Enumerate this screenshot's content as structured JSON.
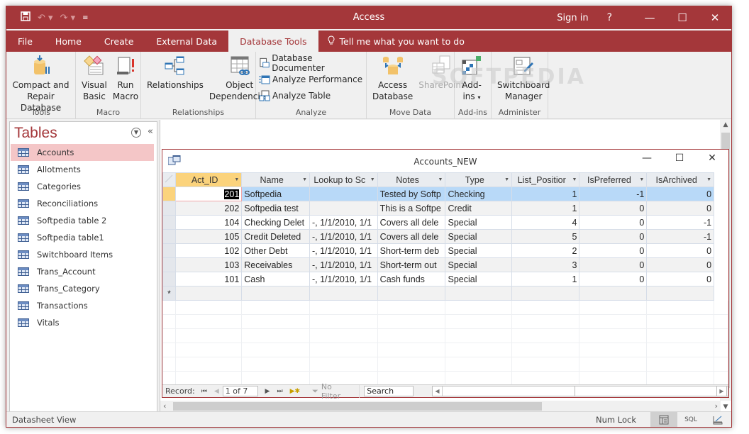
{
  "titlebar": {
    "title": "Access",
    "sign_in": "Sign in",
    "help": "?",
    "qat_icons": [
      "save-icon",
      "undo-icon",
      "redo-icon",
      "customize-qat-icon"
    ]
  },
  "tabs": [
    {
      "label": "File",
      "active": false
    },
    {
      "label": "Home",
      "active": false
    },
    {
      "label": "Create",
      "active": false
    },
    {
      "label": "External Data",
      "active": false
    },
    {
      "label": "Database Tools",
      "active": true
    }
  ],
  "tell_me": "Tell me what you want to do",
  "ribbon": {
    "groups": [
      {
        "label": "Tools",
        "buttons": [
          {
            "label": "Compact and Repair Database"
          }
        ]
      },
      {
        "label": "Macro",
        "buttons": [
          {
            "label": "Visual Basic"
          },
          {
            "label": "Run Macro"
          }
        ]
      },
      {
        "label": "Relationships",
        "buttons": [
          {
            "label": "Relationships"
          },
          {
            "label": "Object Dependencies"
          }
        ]
      },
      {
        "label": "Analyze",
        "buttons": [
          {
            "label": "Database Documenter"
          },
          {
            "label": "Analyze Performance"
          },
          {
            "label": "Analyze Table"
          }
        ]
      },
      {
        "label": "Move Data",
        "buttons": [
          {
            "label": "Access Database"
          },
          {
            "label": "SharePoint",
            "disabled": true
          }
        ]
      },
      {
        "label": "Add-ins",
        "buttons": [
          {
            "label": "Add-ins"
          }
        ]
      },
      {
        "label": "Administer",
        "buttons": [
          {
            "label": "Switchboard Manager"
          }
        ]
      }
    ],
    "labels": {
      "compact1": "Compact and",
      "compact2": "Repair Database",
      "vb1": "Visual",
      "vb2": "Basic",
      "run1": "Run",
      "run2": "Macro",
      "rel": "Relationships",
      "objdep1": "Object",
      "objdep2": "Dependencies",
      "doc": "Database Documenter",
      "perf": "Analyze Performance",
      "table": "Analyze Table",
      "accdb1": "Access",
      "accdb2": "Database",
      "sharepoint": "SharePoint",
      "addins1": "Add-",
      "addins2": "ins",
      "switch1": "Switchboard",
      "switch2": "Manager",
      "g_tools": "Tools",
      "g_macro": "Macro",
      "g_rel": "Relationships",
      "g_analyze": "Analyze",
      "g_move": "Move Data",
      "g_addins": "Add-ins",
      "g_admin": "Administer"
    },
    "watermark": "SOFTPEDIA"
  },
  "nav": {
    "title": "Tables",
    "items": [
      {
        "label": "Accounts",
        "selected": true
      },
      {
        "label": "Allotments"
      },
      {
        "label": "Categories"
      },
      {
        "label": "Reconciliations"
      },
      {
        "label": "Softpedia table 2"
      },
      {
        "label": "Softpedia table1"
      },
      {
        "label": "Switchboard Items"
      },
      {
        "label": "Trans_Account"
      },
      {
        "label": "Trans_Category"
      },
      {
        "label": "Transactions"
      },
      {
        "label": "Vitals"
      }
    ]
  },
  "datasheet": {
    "window_title": "Accounts_NEW",
    "columns": [
      "Act_ID",
      "Name",
      "Lookup to Sc",
      "Notes",
      "Type",
      "List_Positior",
      "IsPreferred",
      "IsArchived"
    ],
    "rows": [
      [
        "201",
        "Softpedia",
        "",
        "Tested by Softp",
        "Checking",
        "1",
        "-1",
        "0"
      ],
      [
        "202",
        "Softpedia test",
        "",
        "This is a Softpe",
        "Credit",
        "1",
        "0",
        "0"
      ],
      [
        "104",
        "Checking Delet",
        "-, 1/1/2010, 1/1",
        "Covers all dele",
        "Special",
        "4",
        "0",
        "-1"
      ],
      [
        "105",
        "Credit Deleted",
        "-, 1/1/2010, 1/1",
        "Covers all dele",
        "Special",
        "5",
        "0",
        "-1"
      ],
      [
        "102",
        "Other Debt",
        "-, 1/1/2010, 1/1",
        "Short-term deb",
        "Special",
        "2",
        "0",
        "0"
      ],
      [
        "103",
        "Receivables",
        "-, 1/1/2010, 1/1",
        "Short-term out",
        "Special",
        "3",
        "0",
        "0"
      ],
      [
        "101",
        "Cash",
        "-, 1/1/2010, 1/1",
        "Cash funds",
        "Special",
        "1",
        "0",
        "0"
      ]
    ],
    "new_row_marker": "*",
    "current_row": 0
  },
  "record_nav": {
    "label": "Record:",
    "position": "1 of 7",
    "filter": "No Filter",
    "search": "Search"
  },
  "status": {
    "left": "Datasheet View",
    "num_lock": "Num Lock",
    "sql": "SQL"
  }
}
